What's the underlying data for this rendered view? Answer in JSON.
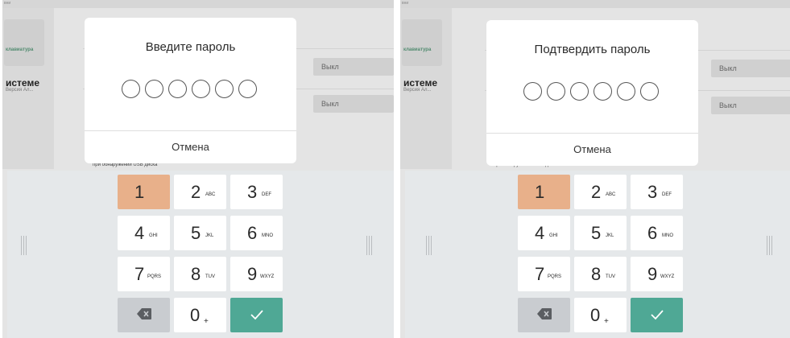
{
  "background": {
    "top_tiny_text": "вни",
    "sidebar_green_label": "клавиатура",
    "sidebar_title": "истеме",
    "sidebar_subtitle": "Версия Ал...",
    "field_value_1": "Выкл",
    "field_value_2": "Выкл",
    "usb_note": "при обнаружении USB диска"
  },
  "screens": [
    {
      "dialog_title": "Введите пароль",
      "cancel_label": "Отмена",
      "digits_entered": 0,
      "digits_total": 6
    },
    {
      "dialog_title": "Подтвердить пароль",
      "cancel_label": "Отмена",
      "digits_entered": 0,
      "digits_total": 6
    }
  ],
  "keypad": {
    "keys": [
      {
        "digit": "1",
        "sub": ""
      },
      {
        "digit": "2",
        "sub": "ABC"
      },
      {
        "digit": "3",
        "sub": "DEF"
      },
      {
        "digit": "4",
        "sub": "GHI"
      },
      {
        "digit": "5",
        "sub": "JKL"
      },
      {
        "digit": "6",
        "sub": "MNO"
      },
      {
        "digit": "7",
        "sub": "PQRS"
      },
      {
        "digit": "8",
        "sub": "TUV"
      },
      {
        "digit": "9",
        "sub": "WXYZ"
      },
      {
        "digit": "0",
        "sub": "+"
      }
    ],
    "backspace_icon": "backspace-icon",
    "confirm_icon": "checkmark-icon"
  },
  "colors": {
    "key_pressed": "#e8b08a",
    "confirm_key": "#4fa895",
    "backspace_key": "#c9ccd0"
  }
}
